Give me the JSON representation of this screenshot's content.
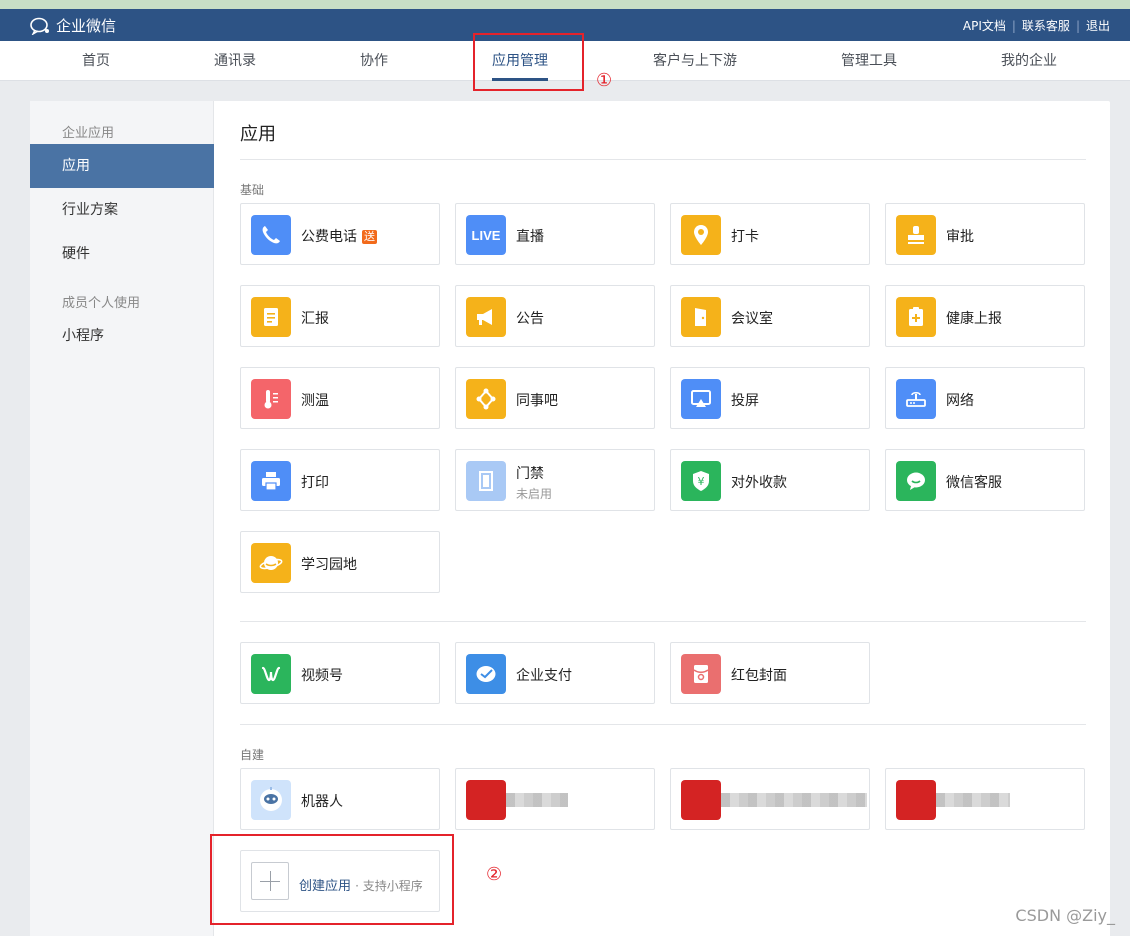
{
  "header": {
    "logo_text": "企业微信",
    "links": [
      "API文档",
      "联系客服",
      "退出"
    ]
  },
  "nav": {
    "items": [
      "首页",
      "通讯录",
      "协作",
      "应用管理",
      "客户与上下游",
      "管理工具",
      "我的企业"
    ],
    "active": "应用管理"
  },
  "sidebar": {
    "group1": "企业应用",
    "items1": [
      "应用",
      "行业方案",
      "硬件"
    ],
    "group2": "成员个人使用",
    "items2": [
      "小程序"
    ]
  },
  "content": {
    "title": "应用",
    "basic_label": "基础",
    "basic_apps": [
      {
        "name": "公费电话",
        "badge": "送",
        "icon": "phone-icon",
        "color": "#4f8ef7"
      },
      {
        "name": "直播",
        "icon": "live-icon",
        "color": "#4f8ef7"
      },
      {
        "name": "打卡",
        "icon": "location-pin-icon",
        "color": "#f5b21a"
      },
      {
        "name": "审批",
        "icon": "stamp-icon",
        "color": "#f5b21a"
      },
      {
        "name": "汇报",
        "icon": "report-icon",
        "color": "#f5b21a"
      },
      {
        "name": "公告",
        "icon": "megaphone-icon",
        "color": "#f5b21a"
      },
      {
        "name": "会议室",
        "icon": "door-icon",
        "color": "#f5b21a"
      },
      {
        "name": "健康上报",
        "icon": "health-icon",
        "color": "#f5b21a"
      },
      {
        "name": "测温",
        "icon": "thermometer-icon",
        "color": "#f4656a"
      },
      {
        "name": "同事吧",
        "icon": "network-icon",
        "color": "#f5b21a"
      },
      {
        "name": "投屏",
        "icon": "screen-cast-icon",
        "color": "#4f8ef7"
      },
      {
        "name": "网络",
        "icon": "router-icon",
        "color": "#4f8ef7"
      },
      {
        "name": "打印",
        "icon": "printer-icon",
        "color": "#4f8ef7"
      },
      {
        "name": "门禁",
        "sub": "未启用",
        "icon": "access-door-icon",
        "color": "#a9c9f5"
      },
      {
        "name": "对外收款",
        "icon": "yuan-shield-icon",
        "color": "#2bb55c"
      },
      {
        "name": "微信客服",
        "icon": "chat-bubble-icon",
        "color": "#2bb55c"
      },
      {
        "name": "学习园地",
        "icon": "planet-icon",
        "color": "#f5b21a"
      }
    ],
    "wechat_apps": [
      {
        "name": "视频号",
        "icon": "channels-icon",
        "color": "#2bb55c"
      },
      {
        "name": "企业支付",
        "icon": "pay-icon",
        "color": "#3d8ee6"
      },
      {
        "name": "红包封面",
        "icon": "red-packet-icon",
        "color": "#ea6f6f"
      }
    ],
    "custom_label": "自建",
    "custom_apps": [
      {
        "name": "机器人",
        "icon": "robot-icon",
        "color": "#cfe3fb"
      }
    ],
    "create": {
      "label": "创建应用",
      "hint": "· 支持小程序"
    }
  },
  "annotations": {
    "mark1": "①",
    "mark2": "②"
  },
  "watermark": "CSDN @Ziy_"
}
